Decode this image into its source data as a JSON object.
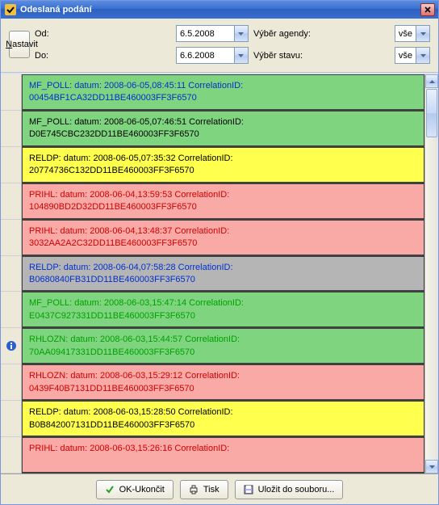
{
  "window": {
    "title": "Odeslaná podání"
  },
  "filters": {
    "od_label": "Od:",
    "do_label": "Do:",
    "od_value": "6.5.2008",
    "do_value": "6.6.2008",
    "agenda_label": "Výběr agendy:",
    "stav_label": "Výběr stavu:",
    "agenda_value": "vše",
    "stav_value": "vše",
    "nastavit_label": "Nastavit"
  },
  "rows": [
    {
      "bg": "bg-green",
      "tc": "blue",
      "l1": "MF_POLL: datum: 2008-06-05,08:45:11 CorrelationID:",
      "l2": "00454BF1CA32DD11BE460003FF3F6570",
      "info": false
    },
    {
      "bg": "bg-green",
      "tc": "black",
      "l1": "MF_POLL: datum: 2008-06-05,07:46:51 CorrelationID:",
      "l2": "D0E745CBC232DD11BE460003FF3F6570",
      "info": false
    },
    {
      "bg": "bg-yellow",
      "tc": "black",
      "l1": "RELDP: datum: 2008-06-05,07:35:32 CorrelationID:",
      "l2": "20774736C132DD11BE460003FF3F6570",
      "info": false
    },
    {
      "bg": "bg-pink",
      "tc": "red",
      "l1": "PRIHL: datum: 2008-06-04,13:59:53 CorrelationID:",
      "l2": "104890BD2D32DD11BE460003FF3F6570",
      "info": false
    },
    {
      "bg": "bg-pink",
      "tc": "red",
      "l1": "PRIHL: datum: 2008-06-04,13:48:37 CorrelationID:",
      "l2": "3032AA2A2C32DD11BE460003FF3F6570",
      "info": false
    },
    {
      "bg": "bg-gray",
      "tc": "blue",
      "l1": "RELDP: datum: 2008-06-04,07:58:28 CorrelationID:",
      "l2": "B0680840FB31DD11BE460003FF3F6570",
      "info": false
    },
    {
      "bg": "bg-green",
      "tc": "green",
      "l1": "MF_POLL: datum: 2008-06-03,15:47:14 CorrelationID:",
      "l2": "E0437C927331DD11BE460003FF3F6570",
      "info": false
    },
    {
      "bg": "bg-green",
      "tc": "green",
      "l1": "RHLOZN: datum: 2008-06-03,15:44:57 CorrelationID:",
      "l2": "70AA09417331DD11BE460003FF3F6570",
      "info": true
    },
    {
      "bg": "bg-pink",
      "tc": "red",
      "l1": "RHLOZN: datum: 2008-06-03,15:29:12 CorrelationID:",
      "l2": "0439F40B7131DD11BE460003FF3F6570",
      "info": false
    },
    {
      "bg": "bg-yellow",
      "tc": "black",
      "l1": "RELDP: datum: 2008-06-03,15:28:50 CorrelationID:",
      "l2": "B0B842007131DD11BE460003FF3F6570",
      "info": false
    },
    {
      "bg": "bg-pink",
      "tc": "red",
      "l1": "PRIHL: datum: 2008-06-03,15:26:16 CorrelationID:",
      "l2": "",
      "info": false
    }
  ],
  "footer": {
    "ok_label": "OK-Ukončit",
    "tisk_label": "Tisk",
    "ulozit_label": "Uložit do souboru..."
  }
}
